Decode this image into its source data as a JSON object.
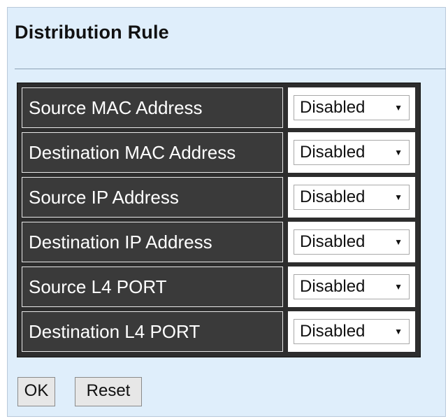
{
  "page": {
    "title": "Distribution Rule"
  },
  "rules": [
    {
      "label": "Source MAC Address",
      "value": "Disabled"
    },
    {
      "label": "Destination MAC Address",
      "value": "Disabled"
    },
    {
      "label": "Source IP Address",
      "value": "Disabled"
    },
    {
      "label": "Destination IP Address",
      "value": "Disabled"
    },
    {
      "label": "Source L4 PORT",
      "value": "Disabled"
    },
    {
      "label": "Destination L4 PORT",
      "value": "Disabled"
    }
  ],
  "buttons": {
    "ok": "OK",
    "reset": "Reset"
  },
  "icons": {
    "dropdown": "caret-down-icon"
  }
}
